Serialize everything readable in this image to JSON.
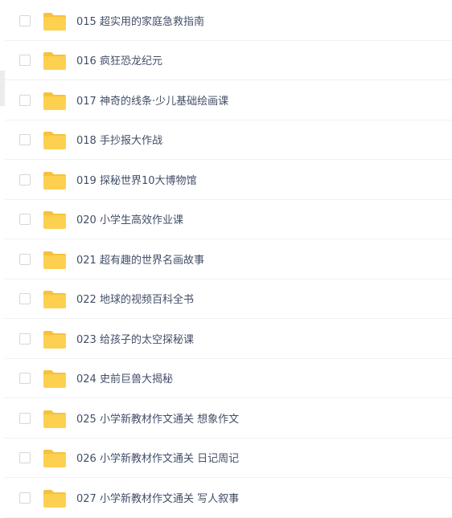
{
  "colors": {
    "folder_fill": "#fdd04f",
    "folder_tab": "#f6c23c",
    "text": "#424e67",
    "divider": "#f0f1f3",
    "checkbox_border": "#d3d6db"
  },
  "icons": {
    "folder": "folder-icon",
    "checkbox": "checkbox"
  },
  "files": [
    {
      "name": "015 超实用的家庭急救指南"
    },
    {
      "name": "016 疯狂恐龙纪元"
    },
    {
      "name": "017 神奇的线条·少儿基础绘画课"
    },
    {
      "name": "018 手抄报大作战"
    },
    {
      "name": "019 探秘世界10大博物馆"
    },
    {
      "name": "020 小学生高效作业课"
    },
    {
      "name": "021 超有趣的世界名画故事"
    },
    {
      "name": "022 地球的视频百科全书"
    },
    {
      "name": "023 给孩子的太空探秘课"
    },
    {
      "name": "024 史前巨兽大揭秘"
    },
    {
      "name": "025 小学新教材作文通关 想象作文"
    },
    {
      "name": "026 小学新教材作文通关 日记周记"
    },
    {
      "name": "027 小学新教材作文通关 写人叙事"
    }
  ]
}
